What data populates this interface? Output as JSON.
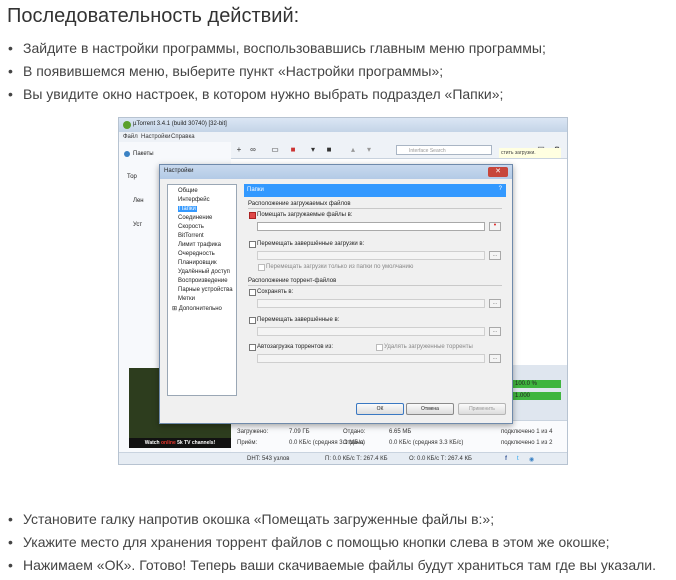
{
  "heading": "Последовательность действий:",
  "steps_top": [
    "Зайдите в настройки программы, воспользовавшись главным меню программы;",
    "В появившемся меню, выберите пункт «Настройки программы»;",
    "Вы увидите окно настроек, в котором нужно выбрать подраздел «Папки»;"
  ],
  "steps_bottom": [
    "Установите галку напротив окошка «Помещать загруженные файлы в:»;",
    "Укажите место для хранения торрент файлов с помощью кнопки слева в этом же окошке;",
    "Нажимаем «ОК». Готово! Теперь ваши скачиваемые файлы будут храниться там где вы указали."
  ],
  "screenshot": {
    "window_title": "µTorrent 3.4.1  (build 30740) [32-bit]",
    "menu": [
      "Файл",
      "Настройки",
      "Справка"
    ],
    "sidebar": [
      "Пакеты",
      "Тор",
      "Лен",
      "Уст"
    ],
    "search_placeholder": "Interface Search",
    "notice": "стить загрузки.",
    "ad_text_pre": "Watch ",
    "ad_text_brand": "online",
    "ad_text_post": " 5k TV channels!",
    "pct_values": [
      "100.0 %",
      "1.000"
    ],
    "stats": {
      "downloaded_label": "Загружено:",
      "downloaded_value": "7.09 ГБ",
      "sent_label": "Отдано:",
      "sent_value": "6.65 МБ",
      "recv_label": "Приём:",
      "recv_value": "0.0 КБ/с (средняя 3.1 МБ/с)",
      "send_label": "Отдача:",
      "send_value": "0.0 КБ/с (средняя 3.3 КБ/с)",
      "conn1": "подключено 1 из 4",
      "conn2": "подключено 1 из 2"
    },
    "status": {
      "dht": "DHT: 543 узлов",
      "down": "П: 0.0 КБ/с Т: 267.4 КБ",
      "up": "О: 0.0 КБ/с Т: 267.4 КБ"
    }
  },
  "dialog": {
    "title": "Настройки",
    "tree": [
      "Общие",
      "Интерфейс",
      "Папки",
      "Соединение",
      "Скорость",
      "BitTorrent",
      "Лимит трафика",
      "Очередность",
      "Планировщик",
      "Удалённый доступ",
      "Воспроизведение",
      "Парные устройства",
      "Метки",
      "Дополнительно"
    ],
    "selected_tree_item": "Папки",
    "pane_title": "Папки",
    "help": "?",
    "section_downloads": "Расположение загружаемых файлов",
    "put_downloads": "Помещать загружаемые файлы в:",
    "move_completed": "Перемещать завершённые загрузки в:",
    "move_only_default": "Перемещать загрузки только из папки по умолчанию",
    "section_torrents": "Расположение торрент-файлов",
    "save_to": "Сохранять в:",
    "move_completed_torrents": "Перемещать завершённые в:",
    "autoload": "Автозагрузка торрентов из:",
    "delete_loaded": "Удалять загруженные торренты",
    "browse": "...",
    "ok": "ОК",
    "cancel": "Отмена",
    "apply": "Применить"
  }
}
